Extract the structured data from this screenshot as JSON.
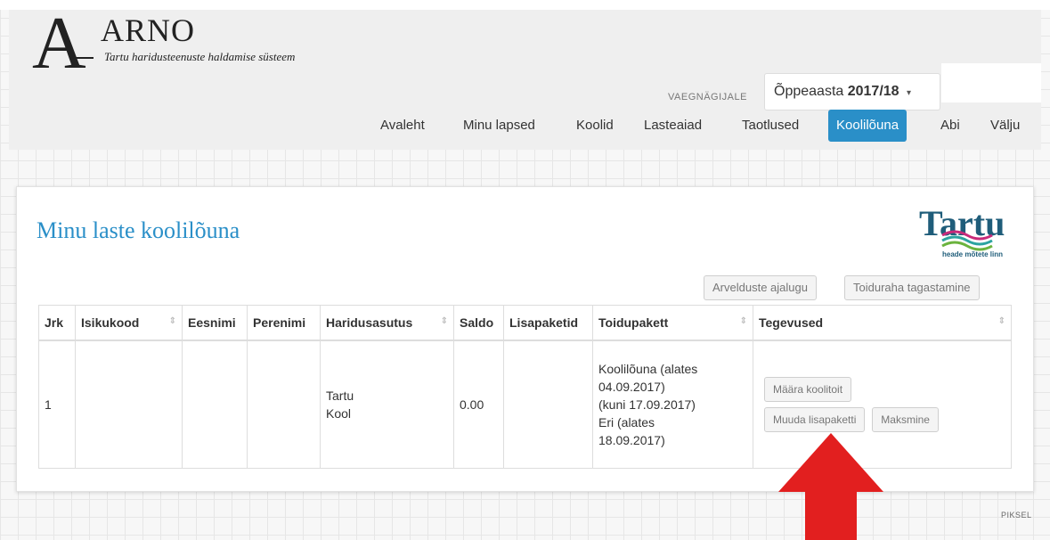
{
  "header": {
    "logo_letter": "A",
    "logo_name": "ARNO",
    "logo_subtitle": "Tartu haridusteenuste haldamise süsteem",
    "viewer_label": "VAEGNÄGIJALE",
    "year_prefix": "Õppeaasta",
    "year_value": "2017/18",
    "year_caret": "▾"
  },
  "nav": {
    "items": [
      "Avaleht",
      "Minu lapsed",
      "Koolid",
      "Lasteaiad",
      "Taotlused",
      "Koolilõuna",
      "Abi",
      "Välju"
    ],
    "active_index": 5,
    "active_color": "#2a8fc8"
  },
  "page": {
    "title": "Minu laste koolilõuna",
    "title_color": "#2a8fc8",
    "logo_text": "Tartu",
    "logo_tagline": "heade mõtete linn"
  },
  "buttons": {
    "billing_history": "Arvelduste ajalugu",
    "food_money_refund": "Toiduraha tagastamine"
  },
  "table": {
    "headers": [
      "Jrk",
      "Isikukood",
      "Eesnimi",
      "Perenimi",
      "Haridusasutus",
      "Saldo",
      "Lisapaketid",
      "Toidupakett",
      "Tegevused"
    ],
    "sort_icon": "⇕",
    "rows": [
      {
        "jrk": "1",
        "isikukood": "",
        "eesnimi": "",
        "perenimi": "",
        "haridusasutus_line1": "Tartu",
        "haridusasutus_line2": "Kool",
        "saldo": "0.00",
        "lisapaketid": "",
        "toidupakett_lines": [
          "Koolilõuna (alates",
          "04.09.2017)",
          "(kuni 17.09.2017)",
          "Eri (alates",
          "18.09.2017)"
        ],
        "actions": {
          "assign_meal": "Määra koolitoit",
          "change_package": "Muuda lisapaketti",
          "payment": "Maksmine"
        }
      }
    ]
  },
  "annotation": {
    "arrow_color": "#e21f1f"
  },
  "footer": {
    "mark": "PIKSEL"
  }
}
